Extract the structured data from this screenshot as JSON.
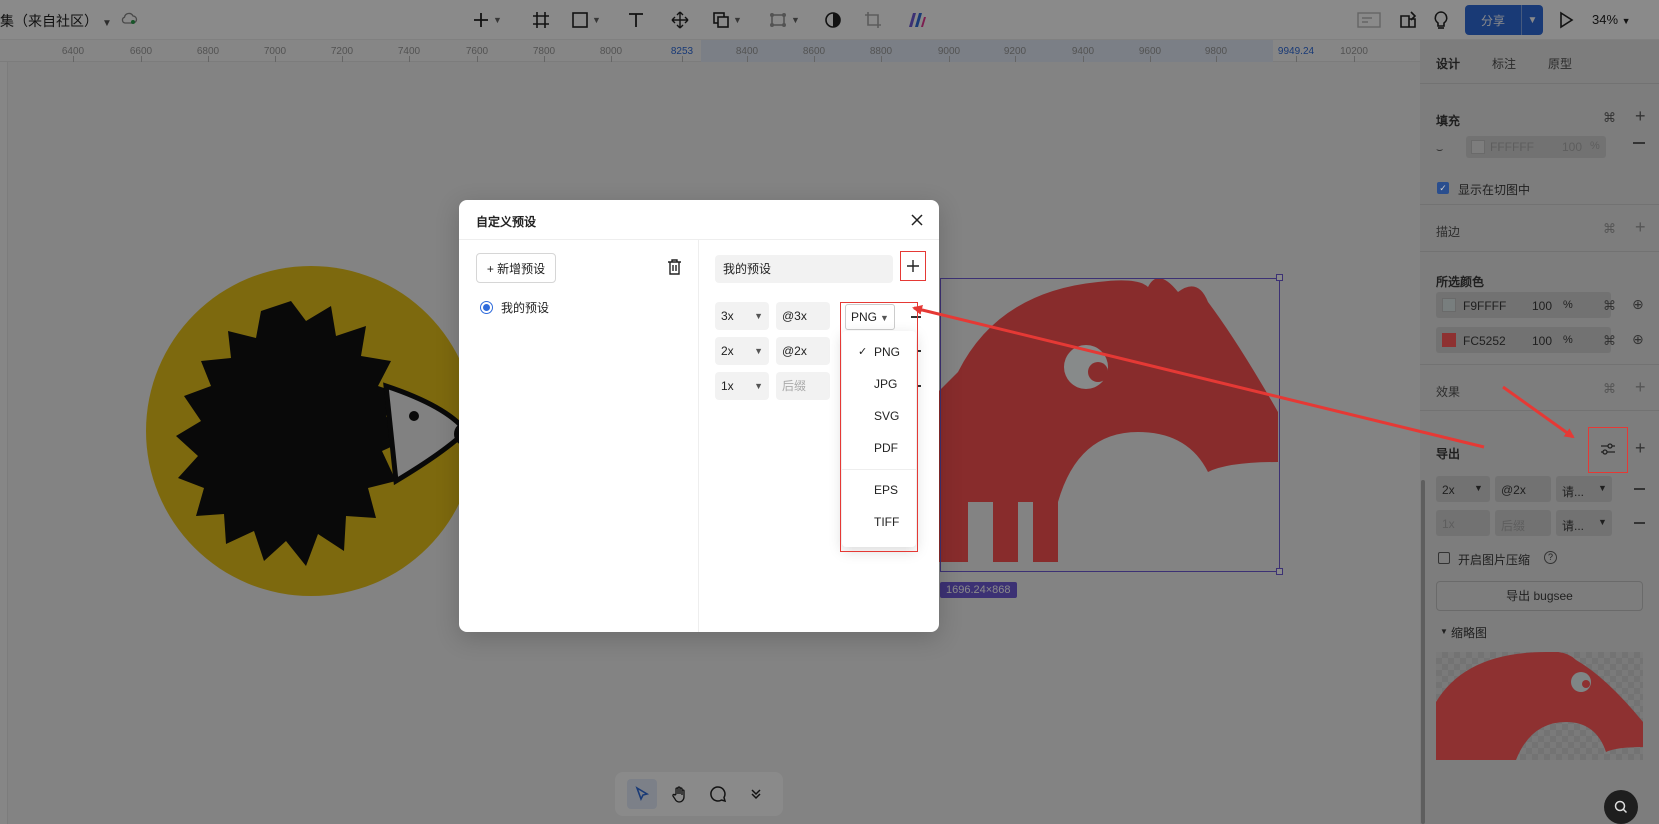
{
  "topbar": {
    "project_name": "集（来自社区）",
    "share_label": "分享",
    "zoom_label": "34%"
  },
  "ruler": {
    "ticks": [
      "6400",
      "6600",
      "6800",
      "7000",
      "7200",
      "7400",
      "7600",
      "7800",
      "8000",
      "8253",
      "8400",
      "8600",
      "8800",
      "9000",
      "9200",
      "9400",
      "9600",
      "9800",
      "9949.24",
      "10200"
    ],
    "highlight": [
      "8253",
      "9949.24"
    ]
  },
  "canvas": {
    "size_tag": "1696.24×868",
    "accent_color": "#6f5bd6",
    "hedgehog_bg_color": "#e8c21a",
    "anteater_color": "#fc5252"
  },
  "bottom_toolbar": {
    "tools": [
      "pointer-icon",
      "hand-icon",
      "comment-icon",
      "more-icon"
    ]
  },
  "right_panel": {
    "tabs": [
      "设计",
      "标注",
      "原型"
    ],
    "fill": {
      "label": "填充",
      "color_hex": "FFFFFF",
      "opacity": "100",
      "percent": "%",
      "show_in_slice": "显示在切图中"
    },
    "stroke_label": "描边",
    "selected_colors": {
      "label": "所选颜色",
      "items": [
        {
          "hex": "F9FFFF",
          "opacity": "100",
          "percent": "%",
          "swatch": "#f9ffff"
        },
        {
          "hex": "FC5252",
          "opacity": "100",
          "percent": "%",
          "swatch": "#fc5252"
        }
      ]
    },
    "effects_label": "效果",
    "export": {
      "label": "导出",
      "rows": [
        {
          "scale": "2x",
          "suffix": "@2x",
          "format": "请..."
        },
        {
          "scale": "1x",
          "suffix": "后缀",
          "format": "请..."
        }
      ],
      "compress_label": "开启图片压缩",
      "export_button": "导出 bugsee",
      "thumbnail_label": "缩略图"
    }
  },
  "dialog": {
    "title": "自定义预设",
    "add_preset": "+ 新增预设",
    "preset_item": "我的预设",
    "preset_name": "我的预设",
    "rows": [
      {
        "scale": "3x",
        "suffix": "@3x"
      },
      {
        "scale": "2x",
        "suffix": "@2x"
      },
      {
        "scale": "1x",
        "suffix": "后缀"
      }
    ],
    "selected_format": "PNG",
    "format_options": [
      "PNG",
      "JPG",
      "SVG",
      "PDF",
      "EPS",
      "TIFF"
    ],
    "checked_format": "PNG"
  }
}
